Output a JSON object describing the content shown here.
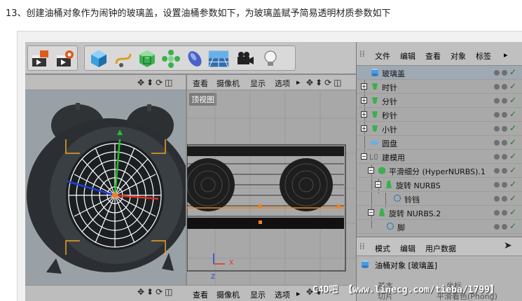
{
  "caption": "13、创建油桶对象作为闹钟的玻璃盖，设置油桶参数如下，为玻璃盖赋予简易透明材质参数如下",
  "toolbar": {
    "icons": [
      "render-view-icon",
      "render-settings-icon",
      "cube-icon",
      "spline-icon",
      "subdivision-icon",
      "array-icon",
      "deformer-icon",
      "floor-icon",
      "camera-icon",
      "light-icon"
    ]
  },
  "viewport_left": {
    "nav": "✥⬍⟳◫"
  },
  "viewport_right": {
    "menu": [
      "查看",
      "摄像机",
      "显示",
      "选项"
    ],
    "arrow": "▸",
    "nav": "✥⬍⟳◫",
    "label": "顶视图",
    "axis_z": "Z",
    "axis_x": "X"
  },
  "bottom_bar": {
    "nav": "✥⬍⟳◫",
    "menu": [
      "查看",
      "摄像机",
      "显示",
      "选项"
    ],
    "arrow": "▸",
    "nav2": "✥⬍"
  },
  "object_manager": {
    "menu": [
      "文件",
      "编辑",
      "查看",
      "对象",
      "标签"
    ],
    "objects": [
      {
        "label": "玻璃盖"
      },
      {
        "label": "时针"
      },
      {
        "label": "分针"
      },
      {
        "label": "秒针"
      },
      {
        "label": "小针"
      },
      {
        "label": "圆盘"
      },
      {
        "label": "建模用"
      },
      {
        "label": "平滑细分 (HyperNURBS).1"
      },
      {
        "label": "旋转 NURBS"
      },
      {
        "label": "铃铛"
      },
      {
        "label": "旋转 NURBS.2"
      },
      {
        "label": "脚"
      }
    ]
  },
  "attribute_manager": {
    "menu": [
      "模式",
      "编辑",
      "用户数据"
    ],
    "title": "油桶对象 [玻璃盖]",
    "tab_basic": "基本",
    "tab_coord": "坐标",
    "tab_slice": "切片",
    "tab_shading": "平滑着色(Phong)"
  },
  "watermark": "C4D吧 【www.linecg.com/tieba/1799】"
}
